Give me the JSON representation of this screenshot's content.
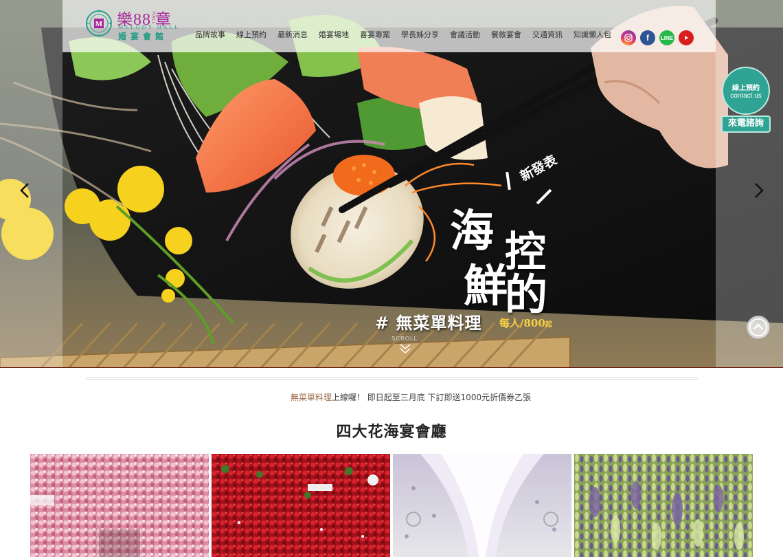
{
  "logo": {
    "name_part1": "樂",
    "name_number": "88",
    "name_part2": "章",
    "name_small": "HALL",
    "english": "MELODY HALL",
    "subtitle": "婚宴會館"
  },
  "nav": {
    "items": [
      {
        "label": "品牌故事"
      },
      {
        "label": "線上預約"
      },
      {
        "label": "最新消息"
      },
      {
        "label": "婚宴場地"
      },
      {
        "label": "喜宴專案"
      },
      {
        "label": "學長姊分享"
      },
      {
        "label": "會議活動"
      },
      {
        "label": "餐敘宴會"
      },
      {
        "label": "交通資訊"
      },
      {
        "label": "知識懶人包"
      }
    ]
  },
  "social": {
    "icons": [
      "instagram-icon",
      "facebook-icon",
      "line-icon",
      "youtube-icon"
    ],
    "line_text": "LINE",
    "fb_text": "f"
  },
  "hero": {
    "badge": "新發表",
    "title_chars": [
      "海",
      "控",
      "鮮",
      "的"
    ],
    "menu_line": "# 無菜單料理",
    "price_label": "每人/800",
    "price_suffix": "起",
    "scroll_label": "SCROLL"
  },
  "contact": {
    "booking_cn": "線上預約",
    "booking_en": "contact us",
    "call_label": "來電諮詢"
  },
  "news": {
    "highlight": "無菜單料理",
    "text": "上線囉！ 即日起至三月底 下訂即送1000元折價券乙張"
  },
  "section": {
    "title": "四大花海宴會廳"
  },
  "colors": {
    "brand_purple": "#a7289b",
    "brand_teal": "#2fa394",
    "news_highlight": "#a0714f",
    "hero_divider": "#6b1d12"
  }
}
